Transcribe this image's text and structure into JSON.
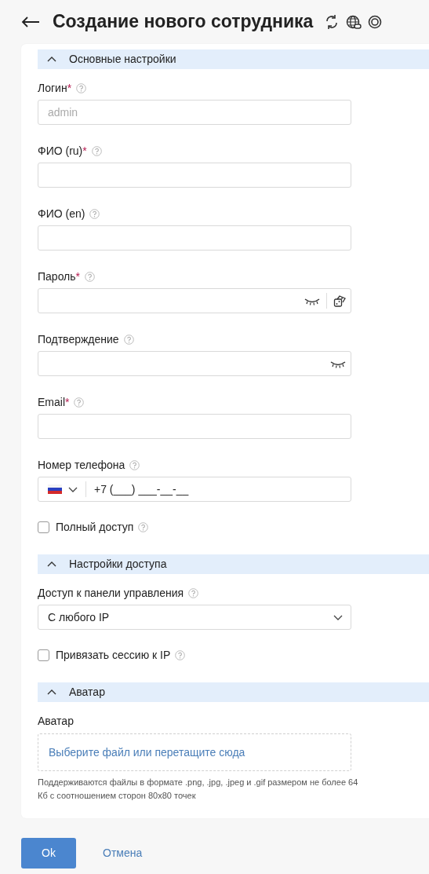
{
  "header": {
    "title": "Создание нового сотрудника",
    "actions": [
      {
        "kind": "refresh"
      },
      {
        "kind": "globe"
      },
      {
        "kind": "help"
      }
    ]
  },
  "sections": [
    {
      "title": "Основные настройки",
      "expanded": true,
      "fields": [
        {
          "kind": "text",
          "label": "Логин",
          "mark": "*",
          "help": true,
          "placeholder": "admin"
        },
        {
          "kind": "text",
          "label": "ФИО (ru)",
          "mark": "*",
          "help": true
        },
        {
          "kind": "text",
          "label": "ФИО (en)",
          "help": true
        },
        {
          "kind": "password",
          "label": "Пароль",
          "mark": "*",
          "help": true,
          "reveal": true,
          "generate": true
        },
        {
          "kind": "password",
          "label": "Подтверждение",
          "help": true,
          "reveal": true
        },
        {
          "kind": "text",
          "label": "Email",
          "mark": "*",
          "help": true
        },
        {
          "kind": "phone",
          "label": "Номер телефона",
          "help": true,
          "value": "+7 (___) ___-__-__"
        },
        {
          "kind": "checkbox",
          "label": "Полный доступ",
          "help": true,
          "checked": false
        }
      ]
    },
    {
      "title": "Настройки доступа",
      "expanded": true,
      "fields": [
        {
          "kind": "select",
          "label": "Доступ к панели управления",
          "help": true,
          "value": "С любого IP"
        },
        {
          "kind": "checkbox",
          "label": "Привязать сессию к IP",
          "help": true,
          "checked": false
        }
      ]
    },
    {
      "title": "Аватар",
      "expanded": true,
      "fields": [
        {
          "kind": "file",
          "label": "Аватар",
          "prompt": "Выберите файл или перетащите сюда",
          "hint": "Поддерживаются файлы в формате .png, .jpg, .jpeg и .gif размером не более 64 Кб с соотношением сторон 80x80 точек"
        }
      ]
    }
  ],
  "footer": {
    "ok": "Ok",
    "cancel": "Отмена"
  }
}
